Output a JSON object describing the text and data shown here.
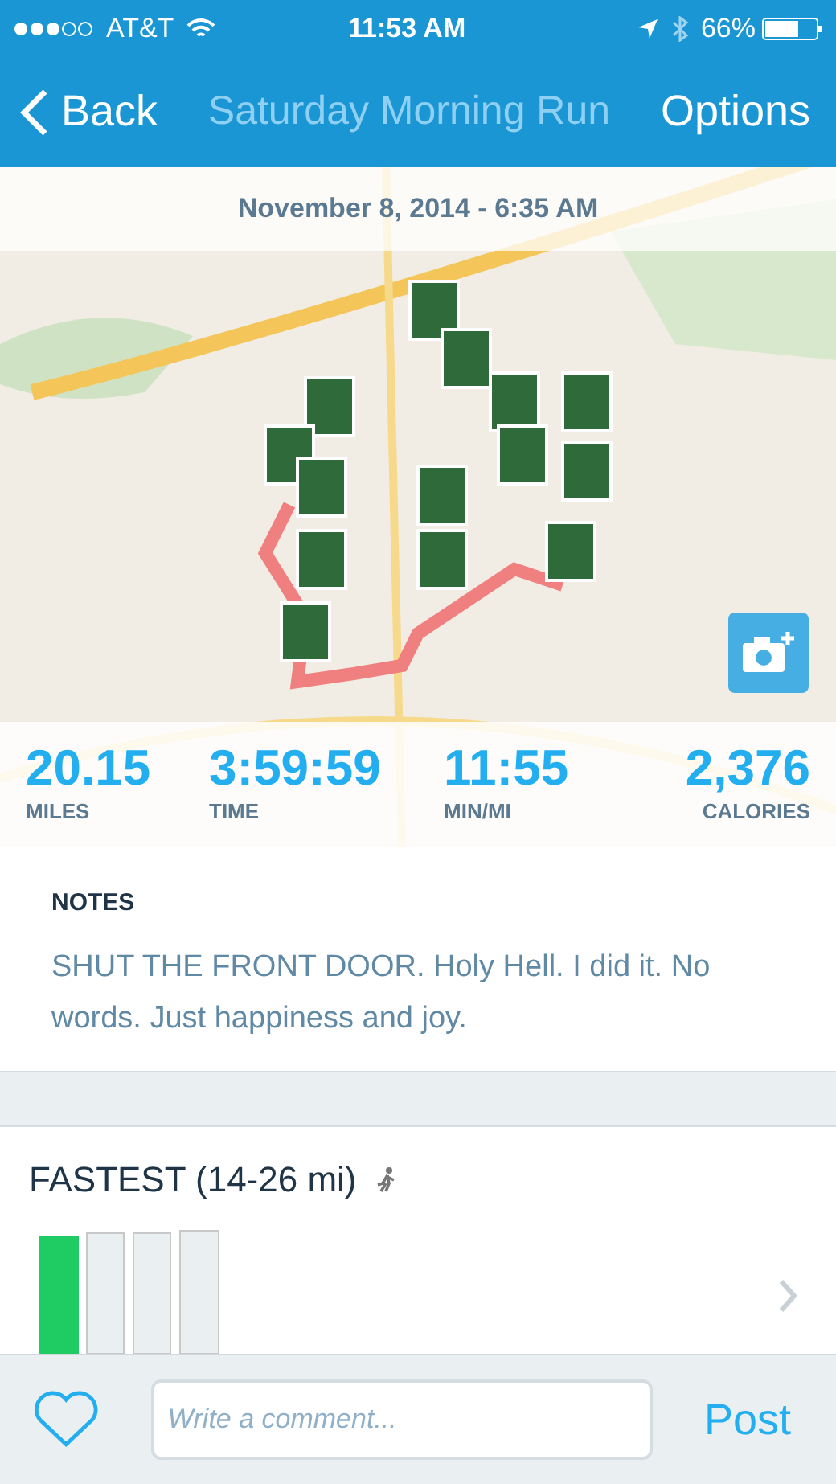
{
  "status_bar": {
    "carrier": "AT&T",
    "time": "11:53 AM",
    "battery": "66%"
  },
  "nav": {
    "back": "Back",
    "title": "Saturday Morning Run",
    "action": "Options"
  },
  "map": {
    "date": "November 8, 2014 - 6:35 AM"
  },
  "stats": [
    {
      "value": "20.15",
      "label": "MILES"
    },
    {
      "value": "3:59:59",
      "label": "TIME"
    },
    {
      "value": "11:55",
      "label": "MIN/MI"
    },
    {
      "value": "2,376",
      "label": "CALORIES"
    }
  ],
  "notes": {
    "heading": "NOTES",
    "text": "SHUT THE FRONT DOOR. Holy Hell. I did it. No words. Just  happiness and joy."
  },
  "fastest": {
    "title": "FASTEST (14-26 mi)"
  },
  "comment_bar": {
    "liked": false,
    "placeholder": "Write a comment...",
    "post": "Post"
  }
}
